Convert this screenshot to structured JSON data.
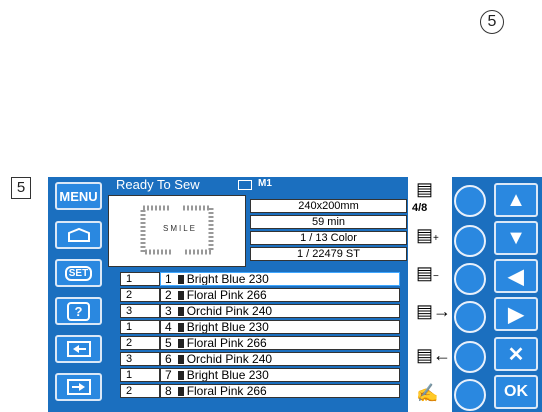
{
  "annotations": {
    "callout_number": "5",
    "step_label": "5"
  },
  "screen": {
    "status_text": "Ready To Sew",
    "memory_label": "M1",
    "design_preview_text": "SMILE",
    "info": {
      "size": "240x200mm",
      "time": "59 min",
      "color_progress": "1 / 13 Color",
      "stitch_progress": "1 / 22479 ST"
    },
    "fraction": "4/8"
  },
  "left_buttons": [
    {
      "label": "MENU",
      "icon": "menu"
    },
    {
      "label": "",
      "icon": "hoop-icon"
    },
    {
      "label": "SET",
      "icon": "set-icon"
    },
    {
      "label": "?",
      "icon": "help-icon"
    },
    {
      "label": "",
      "icon": "arrow-left-box-icon"
    },
    {
      "label": "",
      "icon": "arrow-right-box-icon"
    }
  ],
  "color_rows": [
    {
      "needle": "1",
      "index": "1",
      "name": "Bright Blue 230",
      "highlight": true
    },
    {
      "needle": "2",
      "index": "2",
      "name": "Floral Pink 266"
    },
    {
      "needle": "3",
      "index": "3",
      "name": "Orchid Pink 240"
    },
    {
      "needle": "1",
      "index": "4",
      "name": "Bright Blue 230"
    },
    {
      "needle": "2",
      "index": "5",
      "name": "Floral Pink 266"
    },
    {
      "needle": "3",
      "index": "6",
      "name": "Orchid Pink 240"
    },
    {
      "needle": "1",
      "index": "7",
      "name": "Bright Blue 230"
    },
    {
      "needle": "2",
      "index": "8",
      "name": "Floral Pink 266"
    }
  ],
  "right_icons": [
    "spool-icon",
    "spool-plus-icon",
    "spool-minus-icon",
    "needle-forward-icon",
    "needle-back-icon",
    "hand-icon"
  ],
  "nav_buttons": [
    {
      "label": "▲",
      "icon": "arrow-up-icon"
    },
    {
      "label": "▼",
      "icon": "arrow-down-icon"
    },
    {
      "label": "◀",
      "icon": "arrow-left-icon"
    },
    {
      "label": "▶",
      "icon": "arrow-right-icon"
    },
    {
      "label": "✕",
      "icon": "close-icon"
    },
    {
      "label": "OK",
      "icon": "ok"
    }
  ],
  "colors": {
    "screen_bg": "#1b6fbf",
    "button_bg": "#2a88e0",
    "highlight": "#3fa7ff"
  }
}
